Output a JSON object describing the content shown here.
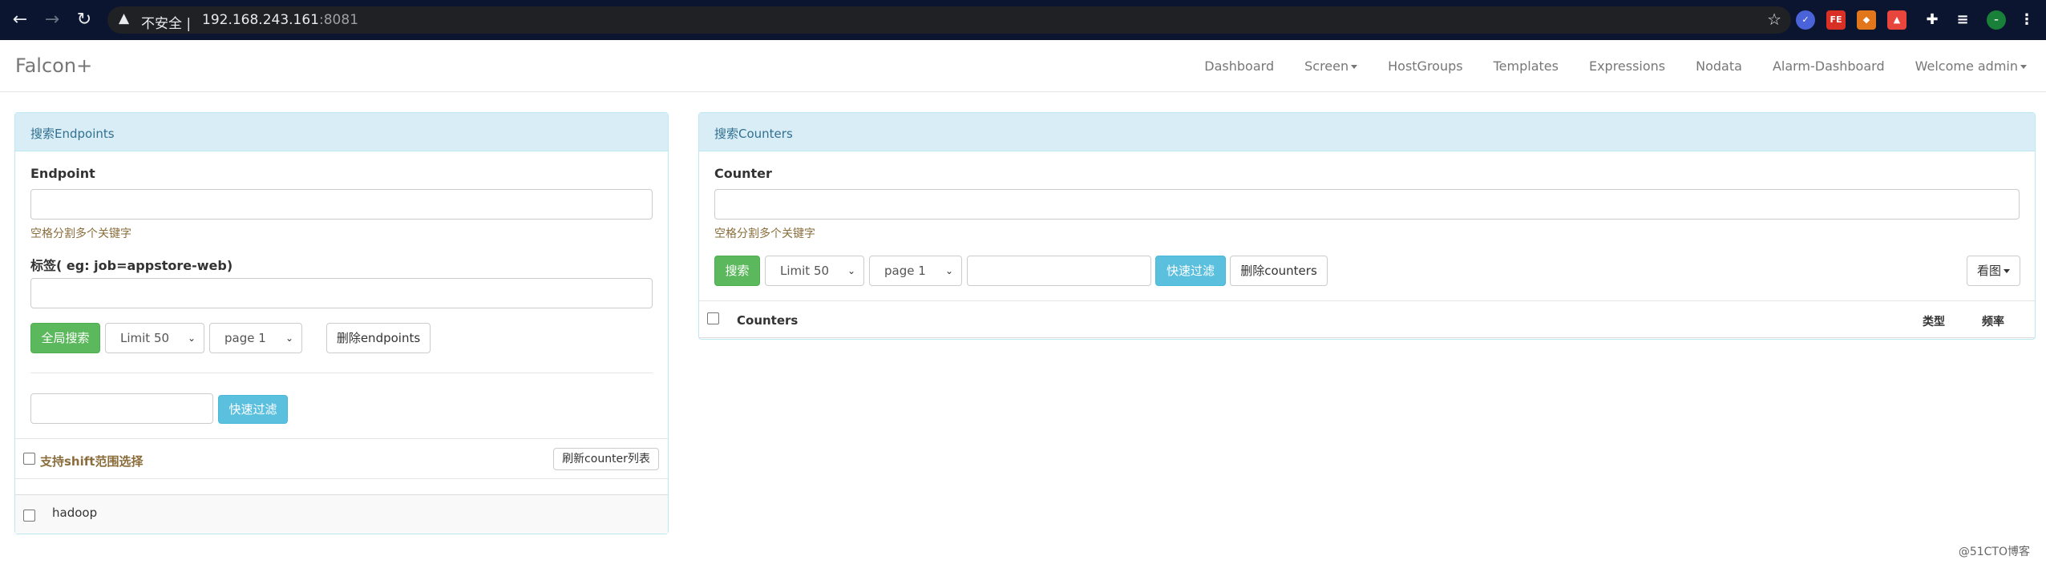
{
  "browser": {
    "security_label": "不安全",
    "separator": "|",
    "host": "192.168.243.161",
    "port": ":8081",
    "extensions": [
      {
        "name": "check-extension",
        "text": "✓",
        "color": "#4a63d8"
      },
      {
        "name": "fe-extension",
        "text": "FE",
        "color": "#d93025"
      },
      {
        "name": "fox-extension",
        "text": "◆",
        "color": "#e2761b"
      },
      {
        "name": "red-extension",
        "text": "▲",
        "color": "#e8453c"
      }
    ]
  },
  "navbar": {
    "brand": "Falcon+",
    "links": [
      "Dashboard",
      "Screen",
      "HostGroups",
      "Templates",
      "Expressions",
      "Nodata",
      "Alarm-Dashboard",
      "Welcome admin"
    ]
  },
  "endpoints_panel": {
    "heading": "搜索Endpoints",
    "endpoint_label": "Endpoint",
    "endpoint_hint": "空格分割多个关键字",
    "tag_label": "标签( eg: job=appstore-web)",
    "search_all_button": "全局搜索",
    "limit_select": "Limit 50",
    "page_select": "page 1",
    "delete_button": "删除endpoints",
    "quick_filter_button": "快速过滤",
    "shift_select_label": "支持shift范围选择",
    "refresh_button": "刷新counter列表",
    "items": [
      "hadoop"
    ]
  },
  "counters_panel": {
    "heading": "搜索Counters",
    "counter_label": "Counter",
    "counter_hint": "空格分割多个关键字",
    "search_button": "搜索",
    "limit_select": "Limit 50",
    "page_select": "page 1",
    "quick_filter_button": "快速过滤",
    "delete_button": "删除counters",
    "view_button": "看图",
    "table_headers": {
      "counters": "Counters",
      "type": "类型",
      "freq": "频率"
    }
  },
  "watermark": "@51CTO博客"
}
